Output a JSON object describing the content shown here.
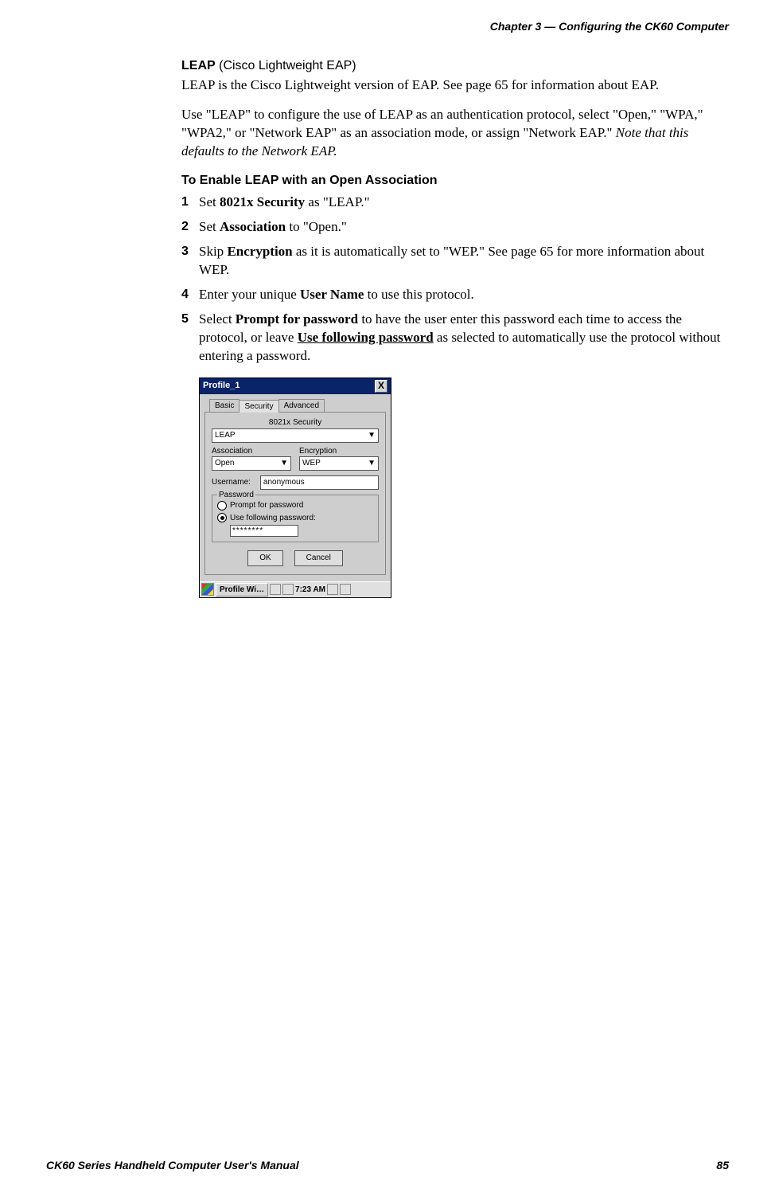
{
  "header": {
    "chapter": "Chapter 3 —  Configuring the CK60 Computer"
  },
  "title": {
    "bold": "LEAP",
    "rest": " (Cisco Lightweight EAP)"
  },
  "intro1": "LEAP is the Cisco Lightweight version of EAP. See page 65 for information about EAP.",
  "intro2a": "Use \"LEAP\" to configure the use of LEAP as an authentication protocol, select \"Open,\" \"WPA,\" \"WPA2,\" or \"Network EAP\" as an association mode, or assign \"Network EAP.\" ",
  "intro2b": "Note that this defaults to the Network EAP.",
  "enable_heading": "To Enable LEAP with an Open Association",
  "steps": {
    "n1": "1",
    "s1a": "Set ",
    "s1b": "8021x Security",
    "s1c": " as \"LEAP.\"",
    "n2": "2",
    "s2a": "Set ",
    "s2b": "Association",
    "s2c": " to \"Open.\"",
    "n3": "3",
    "s3a": "Skip ",
    "s3b": "Encryption",
    "s3c": " as it is automatically set to \"WEP.\" See page 65 for more information about WEP.",
    "n4": "4",
    "s4a": "Enter your unique ",
    "s4b": "User Name",
    "s4c": " to use this protocol.",
    "n5": "5",
    "s5a": "Select ",
    "s5b": "Prompt for password",
    "s5c": " to have the user enter this password each time to access the protocol, or leave ",
    "s5d": "Use following password",
    "s5e": " as selected to automatically use the protocol without entering a password."
  },
  "dialog": {
    "title": "Profile_1",
    "close": "X",
    "tabs": {
      "basic": "Basic",
      "security": "Security",
      "advanced": "Advanced"
    },
    "sec_label": "8021x Security",
    "sec_value": "LEAP",
    "assoc_label": "Association",
    "assoc_value": "Open",
    "enc_label": "Encryption",
    "enc_value": "WEP",
    "user_label": "Username:",
    "user_value": "anonymous",
    "pw_group": "Password",
    "radio1": "Prompt for password",
    "radio2": "Use following password:",
    "pw_value": "********",
    "ok": "OK",
    "cancel": "Cancel",
    "taskbar": {
      "app": "Profile Wi…",
      "time": "7:23 AM"
    }
  },
  "footer": {
    "manual": "CK60 Series Handheld Computer User's Manual",
    "page": "85"
  },
  "chart_data": null
}
